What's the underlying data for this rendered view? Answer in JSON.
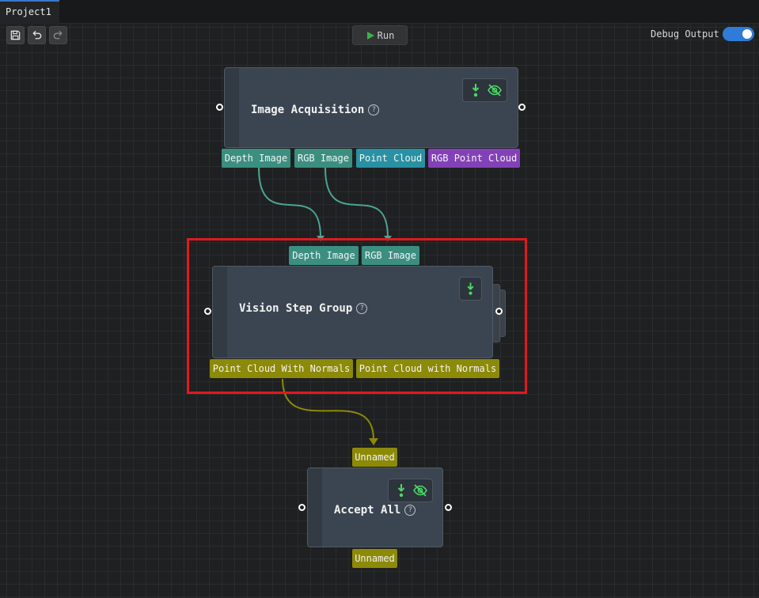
{
  "tabs": [
    {
      "label": "Project1"
    }
  ],
  "toolbar": {
    "save_icon": "save-icon",
    "undo_icon": "undo-icon",
    "redo_icon": "redo-icon",
    "run_label": "Run",
    "debug_label": "Debug Output",
    "debug_enabled": true
  },
  "nodes": {
    "image_acquisition": {
      "title": "Image Acquisition",
      "outputs": [
        "Depth Image",
        "RGB Image",
        "Point Cloud",
        "RGB Point Cloud"
      ]
    },
    "vision_step_group": {
      "title": "Vision Step Group",
      "inputs": [
        "Depth Image",
        "RGB Image"
      ],
      "outputs": [
        "Point Cloud With Normals",
        "Point Cloud with Normals"
      ]
    },
    "accept_all": {
      "title": "Accept All",
      "inputs": [
        "Unnamed"
      ],
      "outputs": [
        "Unnamed"
      ]
    }
  },
  "help_glyph": "?",
  "colors": {
    "teal_port": "#3b8f80",
    "cyan_port": "#2891a3",
    "purple_port": "#8341b8",
    "olive_port": "#8c8a07",
    "icon_green": "#4cd964",
    "accent_blue": "#2f7bd8",
    "highlight_red": "#e0191e"
  }
}
